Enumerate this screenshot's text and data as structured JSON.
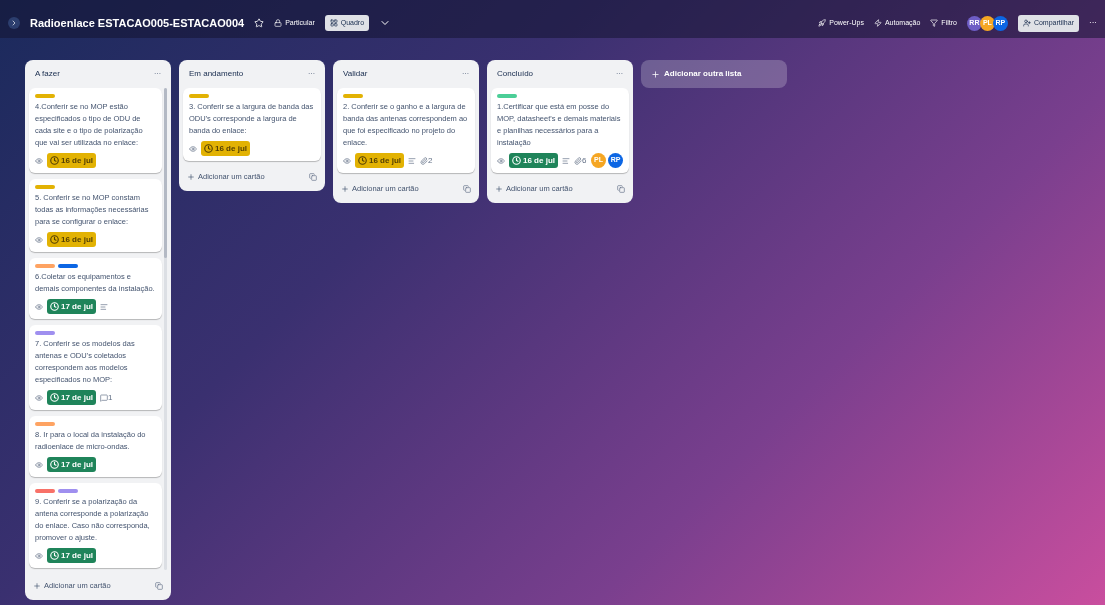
{
  "board": {
    "title": "Radioenlace ESTACAO005-ESTACAO004",
    "starred": false,
    "visibility": "Particular",
    "view": "Quadro"
  },
  "header_actions": [
    "Power-Ups",
    "Automação",
    "Filtro"
  ],
  "header_members": [
    {
      "initials": "RR",
      "color": "#6e5dc6"
    },
    {
      "initials": "PL",
      "color": "#f5a623"
    },
    {
      "initials": "RP",
      "color": "#0c66e4"
    }
  ],
  "share_button": "Compartilhar",
  "more": "···",
  "lists": [
    {
      "title": "A fazer",
      "menu": "···",
      "scrollbar": true,
      "add_card": "Adicionar um cartão",
      "cards": [
        {
          "labels": [
            {
              "color": "#e2b203"
            }
          ],
          "text": "4.Conferir se no MOP estão especificados o tipo de ODU de cada site e o tipo de polarização que vai ser utilizada no enlace:",
          "watching": true,
          "due": {
            "text": "16 de jul",
            "complete": false
          },
          "description": false
        },
        {
          "labels": [
            {
              "color": "#e2b203"
            }
          ],
          "text": "5. Conferir se no MOP constam todas as informações necessárias para se configurar o enlace:",
          "watching": true,
          "due": {
            "text": "16 de jul",
            "complete": false
          },
          "description": false
        },
        {
          "labels": [
            {
              "color": "#fea362"
            },
            {
              "color": "#0c66e4"
            }
          ],
          "text": "6.Coletar os equipamentos e demais componentes da instalação.",
          "watching": true,
          "due": {
            "text": "17 de jul",
            "complete": true
          },
          "description": true
        },
        {
          "labels": [
            {
              "color": "#9f8fef"
            }
          ],
          "text": "7. Conferir se os modelos das antenas e ODU's coletados correspondem aos modelos especificados no MOP:",
          "watching": true,
          "due": {
            "text": "17 de jul",
            "complete": true
          },
          "description": false,
          "comments": "1"
        },
        {
          "labels": [
            {
              "color": "#fea362"
            }
          ],
          "text": "8. Ir para o local da instalação do radioenlace de micro-ondas.",
          "watching": true,
          "due": {
            "text": "17 de jul",
            "complete": true
          },
          "description": false
        },
        {
          "labels": [
            {
              "color": "#f87168"
            },
            {
              "color": "#9f8fef"
            }
          ],
          "text": "9. Conferir se a polarização da antena corresponde a polarização do enlace. Caso não corresponda, promover o ajuste.",
          "watching": true,
          "due": {
            "text": "17 de jul",
            "complete": true
          },
          "description": false
        }
      ]
    },
    {
      "title": "Em andamento",
      "menu": "···",
      "add_card": "Adicionar um cartão",
      "cards": [
        {
          "labels": [
            {
              "color": "#e2b203"
            }
          ],
          "text": "3. Conferir se a largura de banda das ODU's corresponde a largura de banda do enlace:",
          "watching": true,
          "due": {
            "text": "16 de jul",
            "complete": false
          },
          "description": false
        }
      ]
    },
    {
      "title": "Validar",
      "menu": "···",
      "add_card": "Adicionar um cartão",
      "cards": [
        {
          "labels": [
            {
              "color": "#e2b203"
            }
          ],
          "text": "2. Conferir se o ganho e a largura de banda das antenas correspondem ao que foi especificado no projeto do enlace.",
          "watching": true,
          "due": {
            "text": "16 de jul",
            "complete": false
          },
          "description": true,
          "attachments": "2"
        }
      ]
    },
    {
      "title": "Concluído",
      "menu": "···",
      "add_card": "Adicionar um cartão",
      "cards": [
        {
          "labels": [
            {
              "color": "#4bce97"
            }
          ],
          "text": "1.Certificar que está em posse do MOP, datasheet's e demais materiais e planilhas necessários para a instalação",
          "watching": true,
          "due": {
            "text": "16 de jul",
            "complete": true
          },
          "description": true,
          "attachments": "6",
          "members": [
            {
              "initials": "PL",
              "color": "#f5a623"
            },
            {
              "initials": "RP",
              "color": "#0c66e4"
            }
          ]
        }
      ]
    }
  ],
  "add_list": "Adicionar outra lista"
}
